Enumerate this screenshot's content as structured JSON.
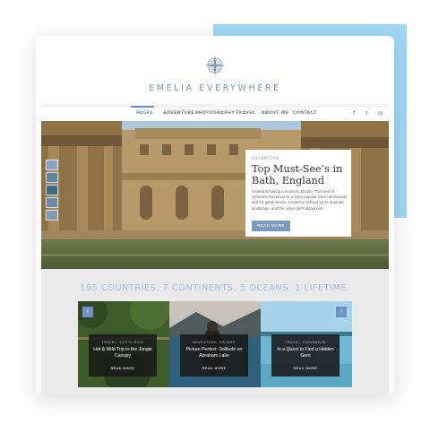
{
  "brand": {
    "name": "EMELIA EVERYWHERE"
  },
  "nav": {
    "items": [
      {
        "label": "PAGES",
        "active": true
      },
      {
        "label": "ADVENTURE",
        "active": false
      },
      {
        "label": "PHOTOGRAPHY",
        "active": false
      },
      {
        "label": "TRAVEL",
        "active": false
      },
      {
        "label": "ABOUT ME",
        "active": false
      },
      {
        "label": "CONTACT",
        "active": false
      }
    ],
    "social": [
      {
        "icon": "facebook-icon",
        "glyph": "f"
      },
      {
        "icon": "twitter-icon",
        "glyph": "𝕥"
      },
      {
        "icon": "instagram-icon",
        "glyph": "◎"
      }
    ]
  },
  "hero": {
    "category": "ADVENTURE",
    "title": "Top Must-See’s in Bath, England",
    "excerpt": "Iceland is having a moment, people. This land of extremes has become a crazy popular travel destination, and for good reason. Iceland is defined by its dramatic landscape, and the views don't disappoint.",
    "button": "READ MORE"
  },
  "tagline": "195 COUNTRIES. 7 CONTINENTS. 5 OCEANS. 1 LIFETIME.",
  "posts": [
    {
      "category": "TRAVEL, COSTA RICA",
      "title": "Hot & Wild Trip to the Jungle Canopy",
      "more": "READ MORE"
    },
    {
      "category": "ADVENTURE, NATURE",
      "title": "Picture Perfect: Solitude on Abraham Lake",
      "more": "READ MORE"
    },
    {
      "category": "TRAVEL, CARIBBEAN",
      "title": "In a Quest to Find a Hidden Gem",
      "more": "READ MORE"
    }
  ],
  "carousel": {
    "prev": "‹",
    "next": "›"
  },
  "colors": {
    "accent": "#9fd8f4",
    "brand": "#7a93b6",
    "button": "#7b9ac2"
  }
}
